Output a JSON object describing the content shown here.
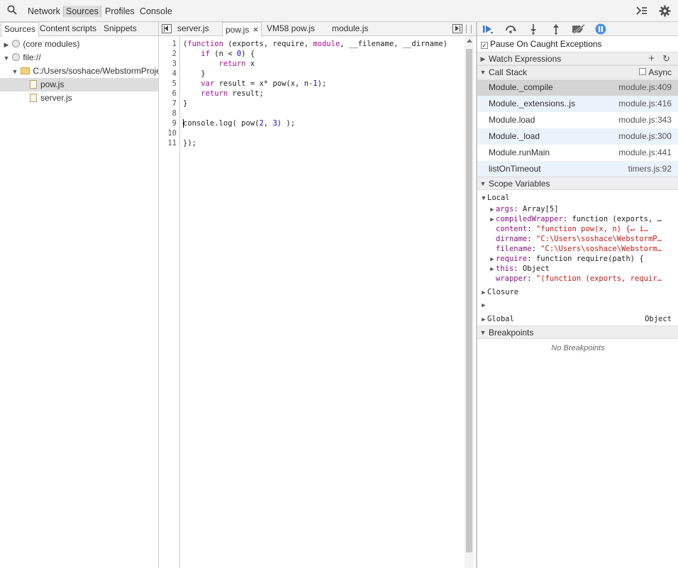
{
  "toolbar": {
    "tabs": [
      "Network",
      "Sources",
      "Profiles",
      "Console"
    ],
    "selected": "Sources"
  },
  "navigator": {
    "tabs": [
      "Sources",
      "Content scripts",
      "Snippets"
    ],
    "tree": [
      {
        "label": "(core modules)",
        "indent": 0
      },
      {
        "label": "file://",
        "indent": 0
      },
      {
        "label": "C:/Users/soshace/WebstormProje",
        "indent": 1
      },
      {
        "label": "pow.js",
        "indent": 2
      },
      {
        "label": "server.js",
        "indent": 2
      }
    ]
  },
  "editor": {
    "tabs": [
      "server.js",
      "pow.js",
      "VM58 pow.js",
      "module.js"
    ],
    "close_glyph": "×",
    "line_numbers": [
      "1",
      "2",
      "3",
      "4",
      "5",
      "6",
      "7",
      "8",
      "9",
      "10",
      "11"
    ],
    "lines": [
      "(function (exports, require, module, __filename, __dirname)",
      "    if (n < 0) {",
      "        return x",
      "    }",
      "    var result = x* pow(x, n-1);",
      "    return result;",
      "}",
      "",
      "console.log( pow(2, 3) );",
      "",
      "});"
    ]
  },
  "debugger": {
    "pause_on_caught": "Pause On Caught Exceptions",
    "watch": "Watch Expressions",
    "call_stack": "Call Stack",
    "async": "Async",
    "frames": [
      {
        "name": "Module._compile",
        "loc": "module.js:409"
      },
      {
        "name": "Module._extensions..js",
        "loc": "module.js:416"
      },
      {
        "name": "Module.load",
        "loc": "module.js:343"
      },
      {
        "name": "Module._load",
        "loc": "module.js:300"
      },
      {
        "name": "Module.runMain",
        "loc": "module.js:441"
      },
      {
        "name": "listOnTimeout",
        "loc": "timers.js:92"
      }
    ],
    "scope_vars": "Scope Variables",
    "local": "Local",
    "locals": [
      {
        "key": "args",
        "value": "Array[5]",
        "expandable": true,
        "str": false
      },
      {
        "key": "compiledWrapper",
        "value": "function (exports, …",
        "expandable": true,
        "str": false
      },
      {
        "key": "content",
        "value": "\"function pow(x, n) {↵    i…",
        "expandable": false,
        "str": true
      },
      {
        "key": "dirname",
        "value": "\"C:\\Users\\soshace\\WebstormP…",
        "expandable": false,
        "str": true
      },
      {
        "key": "filename",
        "value": "\"C:\\Users\\soshace\\Webstorm…",
        "expandable": false,
        "str": true
      },
      {
        "key": "require",
        "value": "function require(path) {",
        "expandable": true,
        "str": false
      },
      {
        "key": "this",
        "value": "Object",
        "expandable": true,
        "str": false
      },
      {
        "key": "wrapper",
        "value": "\"(function (exports, requir…",
        "expandable": false,
        "str": true
      }
    ],
    "closure": "Closure",
    "global": "Global",
    "global_value": "Object",
    "breakpoints": "Breakpoints",
    "no_breakpoints": "No Breakpoints"
  }
}
